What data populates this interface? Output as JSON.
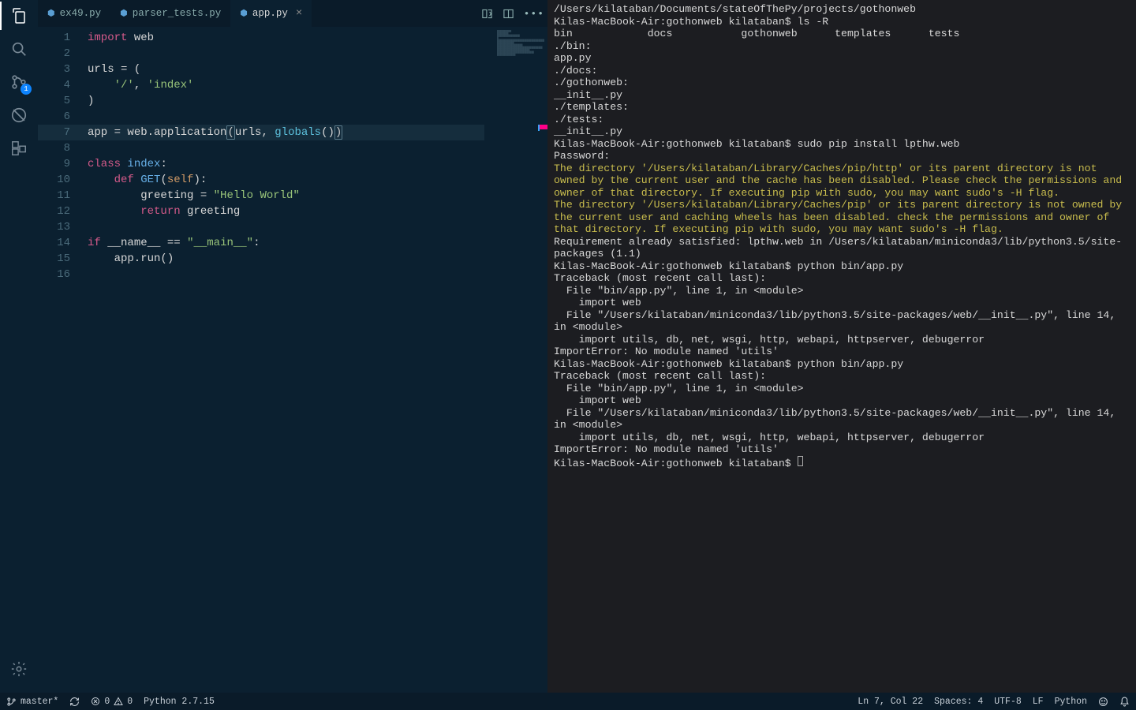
{
  "activity": {
    "scm_badge": "1"
  },
  "tabs": [
    {
      "icon": "py",
      "label": "ex49.py",
      "active": false,
      "close": false
    },
    {
      "icon": "py",
      "label": "parser_tests.py",
      "active": false,
      "close": false
    },
    {
      "icon": "py",
      "label": "app.py",
      "active": true,
      "close": true
    }
  ],
  "code": {
    "line_count": 16,
    "lines": [
      {
        "n": 1,
        "tokens": [
          {
            "t": "import ",
            "c": "kw2"
          },
          {
            "t": "web",
            "c": "var"
          }
        ]
      },
      {
        "n": 2,
        "tokens": []
      },
      {
        "n": 3,
        "tokens": [
          {
            "t": "urls ",
            "c": "var"
          },
          {
            "t": "=",
            "c": "op"
          },
          {
            "t": " (",
            "c": "var"
          }
        ]
      },
      {
        "n": 4,
        "tokens": [
          {
            "t": "    ",
            "c": ""
          },
          {
            "t": "'/'",
            "c": "str"
          },
          {
            "t": ", ",
            "c": "var"
          },
          {
            "t": "'index'",
            "c": "str"
          }
        ]
      },
      {
        "n": 5,
        "tokens": [
          {
            "t": ")",
            "c": "var"
          }
        ]
      },
      {
        "n": 6,
        "tokens": []
      },
      {
        "n": 7,
        "tokens": [
          {
            "t": "app ",
            "c": "var"
          },
          {
            "t": "=",
            "c": "op"
          },
          {
            "t": " web.application",
            "c": "var"
          },
          {
            "t": "(",
            "c": "bracket-match"
          },
          {
            "t": "urls, ",
            "c": "var"
          },
          {
            "t": "globals",
            "c": "fn2"
          },
          {
            "t": "()",
            "c": "var"
          },
          {
            "t": ")",
            "c": "bracket-match"
          }
        ]
      },
      {
        "n": 8,
        "tokens": []
      },
      {
        "n": 9,
        "tokens": [
          {
            "t": "class ",
            "c": "kw2"
          },
          {
            "t": "index",
            "c": "fn"
          },
          {
            "t": ":",
            "c": "var"
          }
        ]
      },
      {
        "n": 10,
        "tokens": [
          {
            "t": "    ",
            "c": ""
          },
          {
            "t": "def ",
            "c": "kw2"
          },
          {
            "t": "GET",
            "c": "fn"
          },
          {
            "t": "(",
            "c": "var"
          },
          {
            "t": "self",
            "c": "num"
          },
          {
            "t": "):",
            "c": "var"
          }
        ]
      },
      {
        "n": 11,
        "tokens": [
          {
            "t": "        greeting ",
            "c": "var"
          },
          {
            "t": "=",
            "c": "op"
          },
          {
            "t": " ",
            "c": ""
          },
          {
            "t": "\"Hello World\"",
            "c": "str"
          }
        ]
      },
      {
        "n": 12,
        "tokens": [
          {
            "t": "        ",
            "c": ""
          },
          {
            "t": "return ",
            "c": "kw2"
          },
          {
            "t": "greeting",
            "c": "var"
          }
        ]
      },
      {
        "n": 13,
        "tokens": []
      },
      {
        "n": 14,
        "tokens": [
          {
            "t": "if ",
            "c": "kw2"
          },
          {
            "t": "__name__ ",
            "c": "var"
          },
          {
            "t": "==",
            "c": "op"
          },
          {
            "t": " ",
            "c": ""
          },
          {
            "t": "\"__main__\"",
            "c": "str"
          },
          {
            "t": ":",
            "c": "var"
          }
        ]
      },
      {
        "n": 15,
        "tokens": [
          {
            "t": "    app.run()",
            "c": "var"
          }
        ]
      },
      {
        "n": 16,
        "tokens": []
      }
    ],
    "cursor_line": 7
  },
  "terminal": {
    "lines": [
      {
        "text": "/Users/kilataban/Documents/stateOfThePy/projects/gothonweb",
        "c": ""
      },
      {
        "text": "Kilas-MacBook-Air:gothonweb kilataban$ ls -R",
        "c": ""
      },
      {
        "text": "bin            docs           gothonweb      templates      tests",
        "c": ""
      },
      {
        "text": "",
        "c": ""
      },
      {
        "text": "./bin:",
        "c": ""
      },
      {
        "text": "app.py",
        "c": ""
      },
      {
        "text": "",
        "c": ""
      },
      {
        "text": "./docs:",
        "c": ""
      },
      {
        "text": "",
        "c": ""
      },
      {
        "text": "./gothonweb:",
        "c": ""
      },
      {
        "text": "__init__.py",
        "c": ""
      },
      {
        "text": "",
        "c": ""
      },
      {
        "text": "./templates:",
        "c": ""
      },
      {
        "text": "",
        "c": ""
      },
      {
        "text": "./tests:",
        "c": ""
      },
      {
        "text": "__init__.py",
        "c": ""
      },
      {
        "text": "Kilas-MacBook-Air:gothonweb kilataban$ sudo pip install lpthw.web",
        "c": ""
      },
      {
        "text": "Password:",
        "c": ""
      },
      {
        "text": "The directory '/Users/kilataban/Library/Caches/pip/http' or its parent directory is not owned by the current user and the cache has been disabled. Please check the permissions and owner of that directory. If executing pip with sudo, you may want sudo's -H flag.",
        "c": "warn"
      },
      {
        "text": "The directory '/Users/kilataban/Library/Caches/pip' or its parent directory is not owned by the current user and caching wheels has been disabled. check the permissions and owner of that directory. If executing pip with sudo, you may want sudo's -H flag.",
        "c": "warn"
      },
      {
        "text": "Requirement already satisfied: lpthw.web in /Users/kilataban/miniconda3/lib/python3.5/site-packages (1.1)",
        "c": ""
      },
      {
        "text": "Kilas-MacBook-Air:gothonweb kilataban$ python bin/app.py",
        "c": ""
      },
      {
        "text": "Traceback (most recent call last):",
        "c": ""
      },
      {
        "text": "  File \"bin/app.py\", line 1, in <module>",
        "c": ""
      },
      {
        "text": "    import web",
        "c": ""
      },
      {
        "text": "  File \"/Users/kilataban/miniconda3/lib/python3.5/site-packages/web/__init__.py\", line 14, in <module>",
        "c": ""
      },
      {
        "text": "    import utils, db, net, wsgi, http, webapi, httpserver, debugerror",
        "c": ""
      },
      {
        "text": "ImportError: No module named 'utils'",
        "c": ""
      },
      {
        "text": "Kilas-MacBook-Air:gothonweb kilataban$ python bin/app.py",
        "c": ""
      },
      {
        "text": "Traceback (most recent call last):",
        "c": ""
      },
      {
        "text": "  File \"bin/app.py\", line 1, in <module>",
        "c": ""
      },
      {
        "text": "    import web",
        "c": ""
      },
      {
        "text": "  File \"/Users/kilataban/miniconda3/lib/python3.5/site-packages/web/__init__.py\", line 14, in <module>",
        "c": ""
      },
      {
        "text": "    import utils, db, net, wsgi, http, webapi, httpserver, debugerror",
        "c": ""
      },
      {
        "text": "ImportError: No module named 'utils'",
        "c": ""
      }
    ],
    "prompt": "Kilas-MacBook-Air:gothonweb kilataban$ "
  },
  "status": {
    "branch": "master*",
    "errors": "0",
    "warnings": "0",
    "python": "Python 2.7.15",
    "position": "Ln 7, Col 22",
    "spaces": "Spaces: 4",
    "encoding": "UTF-8",
    "eol": "LF",
    "lang": "Python"
  }
}
